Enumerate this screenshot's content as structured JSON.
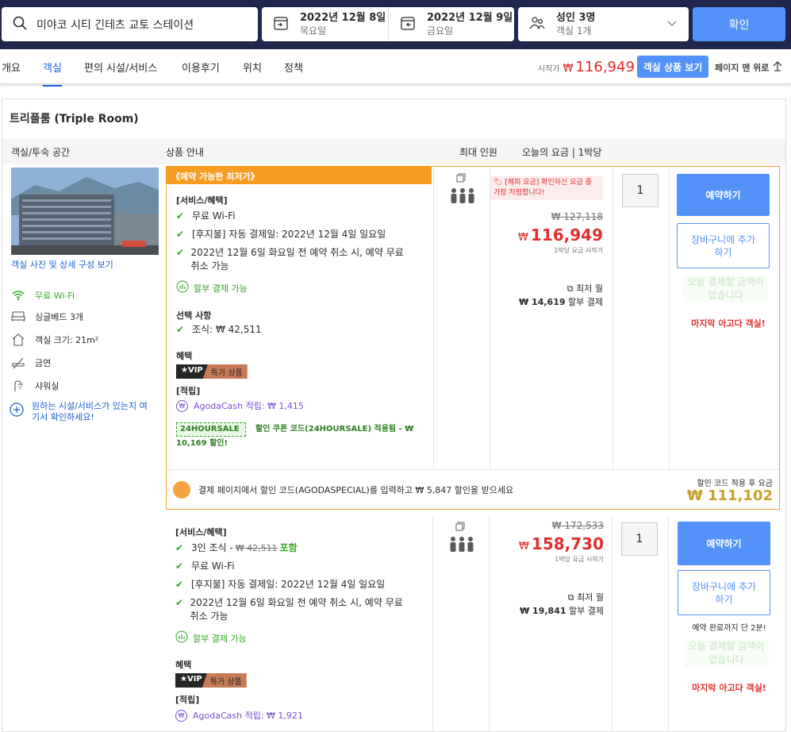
{
  "search": {
    "destination": "미야코 시티 긴테츠 교토 스테이션",
    "checkin_date": "2022년 12월 8일",
    "checkin_day": "목요일",
    "checkout_date": "2022년 12월 9일",
    "checkout_day": "금요일",
    "guests": "성인 3명",
    "rooms": "객실 1개",
    "confirm_label": "확인"
  },
  "tabs": [
    "개요",
    "객실",
    "편의 시설/서비스",
    "이용후기",
    "위치",
    "정책"
  ],
  "active_tab": "객실",
  "header_price": {
    "label": "시작가",
    "currency": "₩",
    "amount": "116,949"
  },
  "view_room_button": "객실 상품 보기",
  "back_to_top": "페이지 맨 위로",
  "room": {
    "title": "트리플룸 (Triple Room)",
    "columns": {
      "room_type": "객실/투숙 공간",
      "product": "상품 안내",
      "max_guests": "최대 인원",
      "price": "오늘의 요금 | 1박당"
    },
    "photo_link": "객실 사진 및 상세 구성 보기",
    "features": [
      {
        "icon": "wifi-icon",
        "label": "무료 Wi-Fi",
        "green": true
      },
      {
        "icon": "bed-icon",
        "label": "싱글베드 3개",
        "green": false
      },
      {
        "icon": "house-icon",
        "label": "객실 크기: 21m²",
        "green": false
      },
      {
        "icon": "no-smoking-icon",
        "label": "금연",
        "green": false
      },
      {
        "icon": "shower-icon",
        "label": "샤워실",
        "green": false
      }
    ],
    "feature_help": "원하는 시설/서비스가 있는지 여기서 확인하세요!"
  },
  "offers": [
    {
      "badge": "《예약 가능한 최저가》",
      "services_title": "[서비스/혜택]",
      "services": [
        "무료 Wi-Fi",
        "[후지불] 자동 결제일: 2022년 12월 4일 일요일",
        "2022년 12월 6일 화요일 전 예약 취소 시, 예약 무료 취소 가능"
      ],
      "installment": "할부 결제 가능",
      "options_title": "선택 사항",
      "options": [
        "조식: ₩ 42,511"
      ],
      "benefits_title": "혜택",
      "vip_a": "★VIP",
      "vip_b": "특가 상품",
      "points_title": "[적립]",
      "agodacash": "AgodaCash 적립: ₩ 1,415",
      "coupon_code": "24HOURSALE",
      "coupon_text": "할인 쿠폰 코드(24HOURSALE) 적용됨 - ₩ 10,169 할인!",
      "price_tag": "[해피 요금] 확인하신 요금 중 가장 저렴합니다!",
      "original_price": "₩ 127,118",
      "currency": "₩",
      "price": "116,949",
      "price_note": "1박당 요금 시작가",
      "installment_label": "최저 월",
      "installment_price": "₩ 14,619",
      "installment_suffix": "할부 결제",
      "qty": "1",
      "book_label": "예약하기",
      "cart_label": "장바구니에 추가하기",
      "no_pay_label": "오늘 결제할 금액이 없습니다",
      "last_room": "마지막 아고다 객실!",
      "footer_text": "결제 페이지에서 할인 코드(AGODASPECIAL)를 입력하고 ₩ 5,847 할인을 받으세요",
      "footer_price_label": "할인 코드 적용 후 요금",
      "footer_price": "₩ 111,102"
    },
    {
      "services_title": "[서비스/혜택]",
      "breakfast_prefix": "3인 조식 - ",
      "breakfast_price": "₩ 42,511",
      "breakfast_included": "포함",
      "services": [
        "무료 Wi-Fi",
        "[후지불] 자동 결제일: 2022년 12월 4일 일요일",
        "2022년 12월 6일 화요일 전 예약 취소 시, 예약 무료 취소 가능"
      ],
      "installment": "할부 결제 가능",
      "benefits_title": "혜택",
      "vip_a": "★VIP",
      "vip_b": "특가 상품",
      "points_title": "[적립]",
      "agodacash": "AgodaCash 적립: ₩ 1,921",
      "original_price": "₩ 172,533",
      "currency": "₩",
      "price": "158,730",
      "price_note": "1박당 요금 시작가",
      "installment_label": "최저 월",
      "installment_price": "₩ 19,841",
      "installment_suffix": "할부 결제",
      "qty": "1",
      "book_label": "예약하기",
      "cart_label": "장바구니에 추가하기",
      "reserve_note": "예약 완료까지 단 2분!",
      "no_pay_label": "오늘 결제할 금액이 없습니다",
      "last_room": "마지막 아고다 객실!"
    }
  ],
  "colors": {
    "accent": "#5392f9",
    "price_red": "#e12d2d",
    "green": "#32a923",
    "best_orange": "#f79c23",
    "nav_dark": "#20274d"
  }
}
